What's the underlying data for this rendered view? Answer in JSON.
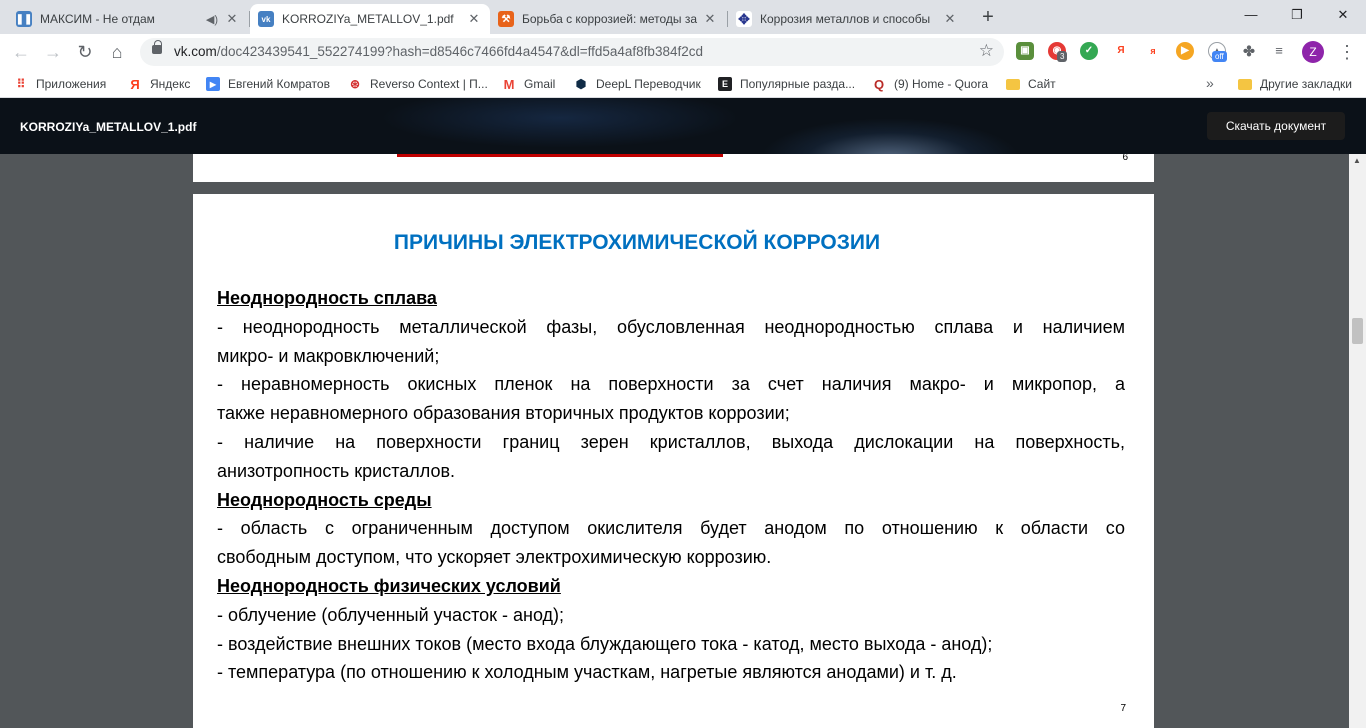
{
  "tabs": [
    {
      "title": "МАКСИМ - Не отдам",
      "favicon": "pause-icon",
      "color": "#4680c2",
      "audio": true,
      "active": false
    },
    {
      "title": "KORROZIYa_METALLOV_1.pdf",
      "favicon": "vk-icon",
      "color": "#4680c2",
      "audio": false,
      "active": true
    },
    {
      "title": "Борьба с коррозией: методы за",
      "favicon": "hammer-icon",
      "color": "#e8631a",
      "audio": false,
      "active": false
    },
    {
      "title": "Коррозия металлов и способы",
      "favicon": "diamond-icon",
      "color": "#2b3990",
      "audio": false,
      "active": false
    }
  ],
  "window_controls": {
    "minimize": "—",
    "restore": "❐",
    "close": "✕"
  },
  "toolbar": {
    "url_host": "vk.com",
    "url_path": "/doc423439541_552274199?hash=d8546c7466fd4a4547&dl=ffd5a4af8fb384f2cd",
    "extension_badge": "3",
    "extension_off_label": "off",
    "profile_initial": "Z"
  },
  "bookmarks": [
    {
      "label": "Приложения",
      "icon": "apps-grid-icon",
      "color": "#ea4335"
    },
    {
      "label": "Яндекс",
      "icon": "yandex-icon",
      "color": "#fc3f1d"
    },
    {
      "label": "Евгений Комратов",
      "icon": "video-icon",
      "color": "#4285f4"
    },
    {
      "label": "Reverso Context | П...",
      "icon": "reverso-icon",
      "color": "#d32f2f"
    },
    {
      "label": "Gmail",
      "icon": "gmail-icon",
      "color": "#ea4335"
    },
    {
      "label": "DeepL Переводчик",
      "icon": "deepl-icon",
      "color": "#0f2b46"
    },
    {
      "label": "Популярные разда...",
      "icon": "e-icon",
      "color": "#202124"
    },
    {
      "label": "(9) Home - Quora",
      "icon": "quora-icon",
      "color": "#b92b27"
    },
    {
      "label": "Сайт",
      "icon": "folder-icon",
      "color": "#f4c542"
    },
    {
      "label": "Другие закладки",
      "icon": "folder-icon",
      "color": "#f4c542"
    }
  ],
  "doc_header": {
    "filename": "KORROZIYa_METALLOV_1.pdf",
    "download_label": "Скачать документ"
  },
  "viewer": {
    "prev_page_number": "6",
    "page_number": "7",
    "heading": "ПРИЧИНЫ ЭЛЕКТРОХИМИЧЕСКОЙ КОРРОЗИИ",
    "sections": [
      {
        "title": "Неоднородность сплава",
        "lines": [
          "- неоднородность металлической фазы, обусловленная неоднородностью сплава и наличием",
          "микро-  и макровключений;",
          "- неравномерность  окисных пленок на поверхности за счет наличия макро-  и микропор, а",
          "также неравномерного образования вторичных продуктов коррозии;",
          "- наличие на поверхности границ зерен кристаллов, выхода дислокации на поверхность,",
          "анизотропность кристаллов."
        ]
      },
      {
        "title": "Неоднородность среды",
        "lines": [
          "- область с ограниченным доступом окислителя будет анодом по отношению к области со",
          "свободным доступом, что ускоряет электрохимическую коррозию."
        ]
      },
      {
        "title": "Неоднородность физических условий",
        "lines": [
          "- облучение (облученный участок - анод);",
          "- воздействие внешних токов (место входа блуждающего тока - катод, место выхода - анод);",
          "- температура (по отношению к холодным участкам, нагретые являются анодами) и т. д."
        ]
      }
    ]
  }
}
